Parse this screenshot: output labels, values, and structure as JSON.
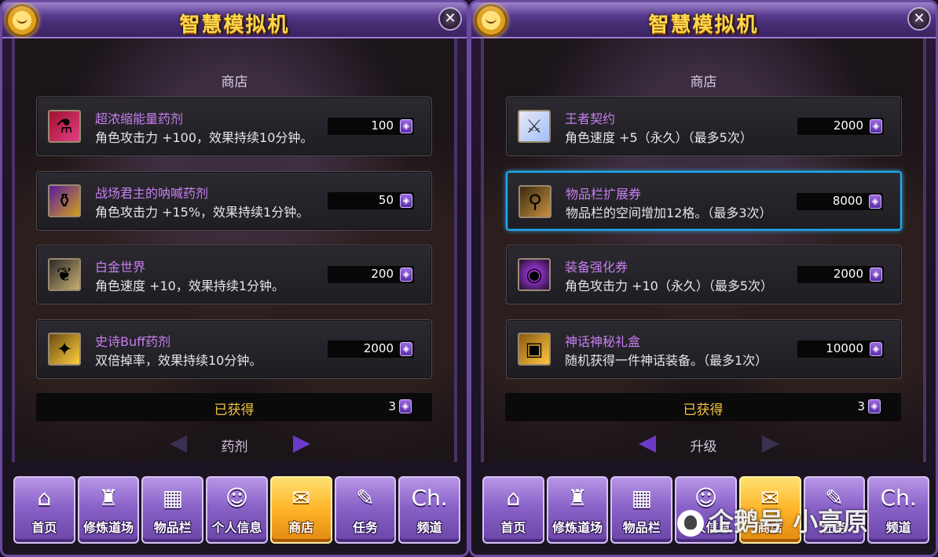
{
  "colors": {
    "item_name": "#c77ef0",
    "obtained_label": "#f0c040",
    "title": "#ffd84a",
    "selected_border": "#2aa8e8"
  },
  "panels": [
    {
      "title": "智慧模拟机",
      "close_label": "✕",
      "section_title": "商店",
      "items": [
        {
          "icon": "potion-red-icon",
          "glyph": "⚗",
          "name": "超浓缩能量药剂",
          "desc": "角色攻击力 +100，效果持续10分钟。",
          "price": "100"
        },
        {
          "icon": "potion-purple-icon",
          "glyph": "⚱",
          "name": "战场君主的呐喊药剂",
          "desc": "角色攻击力 +15%，效果持续1分钟。",
          "price": "50"
        },
        {
          "icon": "wings-icon",
          "glyph": "❦",
          "name": "白金世界",
          "desc": "角色速度 +10，效果持续1分钟。",
          "price": "200"
        },
        {
          "icon": "potion-gold-icon",
          "glyph": "✦",
          "name": "史诗Buff药剂",
          "desc": "双倍掉率，效果持续10分钟。",
          "price": "2000"
        }
      ],
      "obtained_label": "已获得",
      "obtained_count": "3",
      "page_label": "药剂",
      "nav": [
        {
          "label": "首页",
          "glyph": "⌂",
          "icon": "home-icon"
        },
        {
          "label": "修炼道场",
          "glyph": "♜",
          "icon": "dojo-icon"
        },
        {
          "label": "物品栏",
          "glyph": "▦",
          "icon": "inventory-icon"
        },
        {
          "label": "个人信息",
          "glyph": "☺",
          "icon": "profile-icon"
        },
        {
          "label": "商店",
          "glyph": "✉",
          "icon": "shop-icon"
        },
        {
          "label": "任务",
          "glyph": "✎",
          "icon": "quest-icon"
        },
        {
          "label": "频道",
          "glyph": "Ch.",
          "icon": "channel-icon"
        }
      ],
      "active_nav": 4
    },
    {
      "title": "智慧模拟机",
      "close_label": "✕",
      "section_title": "商店",
      "items": [
        {
          "icon": "swords-icon",
          "glyph": "⚔",
          "name": "王者契约",
          "desc": "角色速度 +5（永久）（最多5次）",
          "price": "2000"
        },
        {
          "icon": "bag-icon",
          "glyph": "⚲",
          "name": "物品栏扩展券",
          "desc": "物品栏的空间增加12格。（最多3次）",
          "price": "8000"
        },
        {
          "icon": "gem-icon",
          "glyph": "◉",
          "name": "装备强化券",
          "desc": "角色攻击力 +10（永久）（最多5次）",
          "price": "2000"
        },
        {
          "icon": "chest-icon",
          "glyph": "▣",
          "name": "神话神秘礼盒",
          "desc": "随机获得一件神话装备。（最多1次）",
          "price": "10000"
        }
      ],
      "obtained_label": "已获得",
      "obtained_count": "3",
      "page_label": "升级",
      "nav": [
        {
          "label": "首页",
          "glyph": "⌂",
          "icon": "home-icon"
        },
        {
          "label": "修炼道场",
          "glyph": "♜",
          "icon": "dojo-icon"
        },
        {
          "label": "物品栏",
          "glyph": "▦",
          "icon": "inventory-icon"
        },
        {
          "label": "个人信息",
          "glyph": "☺",
          "icon": "profile-icon"
        },
        {
          "label": "商店",
          "glyph": "✉",
          "icon": "shop-icon"
        },
        {
          "label": "任务",
          "glyph": "✎",
          "icon": "quest-icon"
        },
        {
          "label": "频道",
          "glyph": "Ch.",
          "icon": "channel-icon"
        }
      ],
      "active_nav": 4,
      "selected_item": 1
    }
  ],
  "watermark": "企鹅号 小亮原",
  "coin_glyph": "◈"
}
